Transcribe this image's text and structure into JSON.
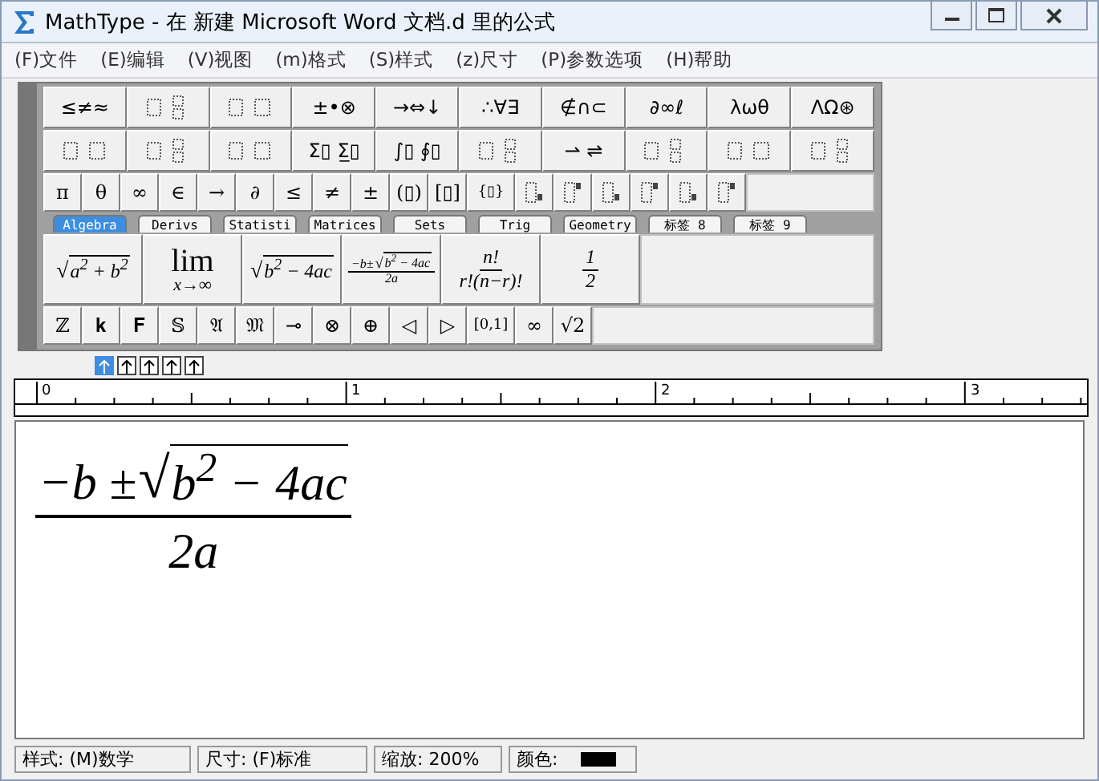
{
  "window": {
    "title": "MathType - 在 新建 Microsoft Word 文档.d 里的公式"
  },
  "menu": [
    "(F)文件",
    "(E)编辑",
    "(V)视图",
    "(m)格式",
    "(S)样式",
    "(z)尺寸",
    "(P)参数选项",
    "(H)帮助"
  ],
  "symbol_palettes": [
    {
      "kind": "text",
      "label": "≤≠≈"
    },
    {
      "kind": "icon"
    },
    {
      "kind": "icon"
    },
    {
      "kind": "text",
      "label": "±•⊗"
    },
    {
      "kind": "text",
      "label": "→⇔↓"
    },
    {
      "kind": "text",
      "label": "∴∀∃"
    },
    {
      "kind": "text",
      "label": "∉∩⊂"
    },
    {
      "kind": "text",
      "label": "∂∞ℓ"
    },
    {
      "kind": "text",
      "label": "λωθ"
    },
    {
      "kind": "text",
      "label": "ΛΩ⊛"
    }
  ],
  "template_palettes": [
    {
      "kind": "icon"
    },
    {
      "kind": "icon"
    },
    {
      "kind": "icon"
    },
    {
      "kind": "text",
      "label": "Σ▯ Σ̲▯"
    },
    {
      "kind": "text",
      "label": "∫▯ ∮▯"
    },
    {
      "kind": "icon"
    },
    {
      "kind": "text",
      "label": "⇀ ⇌"
    },
    {
      "kind": "icon"
    },
    {
      "kind": "icon"
    },
    {
      "kind": "icon"
    }
  ],
  "symbol_bar": [
    {
      "kind": "text",
      "label": "π"
    },
    {
      "kind": "text",
      "label": "θ"
    },
    {
      "kind": "text",
      "label": "∞"
    },
    {
      "kind": "text",
      "label": "∈"
    },
    {
      "kind": "text",
      "label": "→"
    },
    {
      "kind": "text",
      "label": "∂"
    },
    {
      "kind": "text",
      "label": "≤"
    },
    {
      "kind": "text",
      "label": "≠"
    },
    {
      "kind": "text",
      "label": "±"
    },
    {
      "kind": "text",
      "label": "(▯)"
    },
    {
      "kind": "text",
      "label": "[▯]"
    },
    {
      "kind": "text",
      "label": "{▯}"
    },
    {
      "kind": "icon"
    },
    {
      "kind": "icon"
    },
    {
      "kind": "icon"
    },
    {
      "kind": "icon"
    },
    {
      "kind": "icon"
    },
    {
      "kind": "icon"
    }
  ],
  "tabs": [
    {
      "label": "Algebra",
      "selected": true
    },
    {
      "label": "Derivs",
      "selected": false
    },
    {
      "label": "Statisti",
      "selected": false
    },
    {
      "label": "Matrices",
      "selected": false
    },
    {
      "label": "Sets",
      "selected": false
    },
    {
      "label": "Trig",
      "selected": false
    },
    {
      "label": "Geometry",
      "selected": false
    },
    {
      "label": "标签 8",
      "selected": false
    },
    {
      "label": "标签 9",
      "selected": false
    }
  ],
  "templates": [
    {
      "kind": "radical",
      "sign": "√",
      "radicand": "a$^{2}$ + b$^{2}$"
    },
    {
      "kind": "limit",
      "top": "lim",
      "bottom": "x→∞"
    },
    {
      "kind": "radical",
      "sign": "√",
      "radicand": "b$^{2}$ − 4ac"
    },
    {
      "kind": "quadratic",
      "prefix": "−b±",
      "sign": "√",
      "radicand": "b$^{2}$ − 4ac",
      "denominator": "2a"
    },
    {
      "kind": "fraction",
      "numerator": "*n*!",
      "denominator": "*r*!(*n*−*r*)!"
    },
    {
      "kind": "fraction",
      "numerator": "1",
      "denominator": "2"
    }
  ],
  "symbol_bar_2": [
    {
      "kind": "text",
      "label": "ℤ"
    },
    {
      "kind": "text",
      "label": "𝐤"
    },
    {
      "kind": "text",
      "label": "𝐅"
    },
    {
      "kind": "text",
      "label": "𝕊"
    },
    {
      "kind": "text",
      "label": "𝔄"
    },
    {
      "kind": "text",
      "label": "𝔐"
    },
    {
      "kind": "text",
      "label": "⊸"
    },
    {
      "kind": "text",
      "label": "⊗"
    },
    {
      "kind": "text",
      "label": "⊕"
    },
    {
      "kind": "text",
      "label": "◁"
    },
    {
      "kind": "text",
      "label": "▷"
    },
    {
      "kind": "text",
      "label": "[0,1]"
    },
    {
      "kind": "text",
      "label": "∞"
    },
    {
      "kind": "text",
      "label": "√2"
    }
  ],
  "nudge_buttons": [
    {
      "selected": true
    },
    {
      "selected": false
    },
    {
      "selected": false
    },
    {
      "selected": false
    },
    {
      "selected": false
    }
  ],
  "ruler": {
    "labels": [
      "0",
      "1",
      "2",
      "3"
    ]
  },
  "equation": {
    "prefix": "−b ±",
    "sign": "√",
    "radicand": "b$^{2}$ − 4ac",
    "denominator": "2a"
  },
  "status_bar": {
    "style": "样式: (M)数学",
    "size": "尺寸: (F)标准",
    "zoom": "缩放: 200%",
    "color_label": "颜色:",
    "color": "#000000"
  }
}
